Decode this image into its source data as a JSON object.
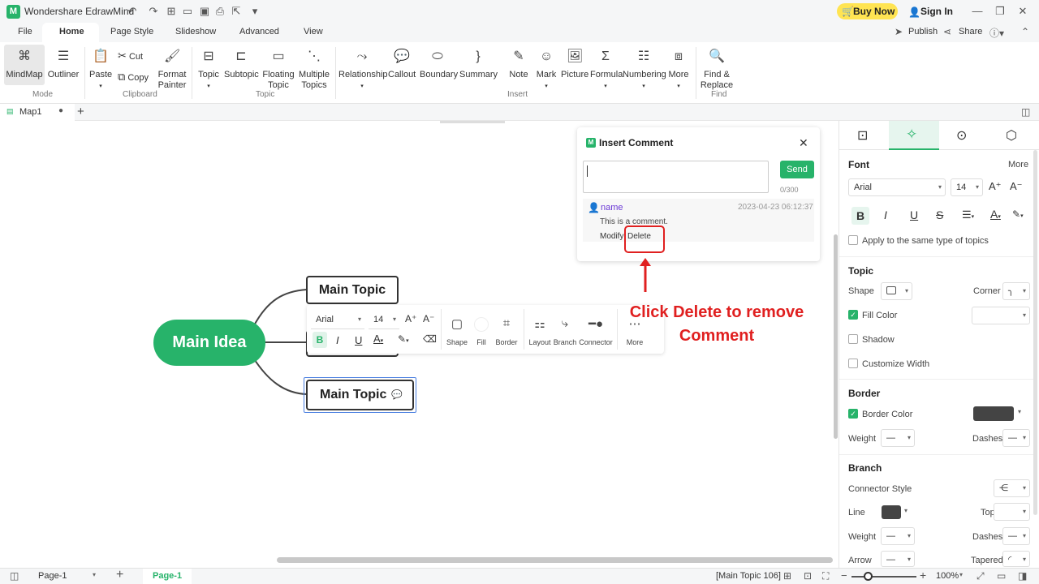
{
  "app": {
    "title": "Wondershare EdrawMind",
    "buy_now": "Buy Now",
    "sign_in": "Sign In",
    "publish": "Publish",
    "share": "Share"
  },
  "menu": [
    "File",
    "Home",
    "Page Style",
    "Slideshow",
    "Advanced",
    "View"
  ],
  "ribbon": {
    "mode": {
      "label": "Mode",
      "mindmap": "MindMap",
      "outliner": "Outliner"
    },
    "clipboard": {
      "label": "Clipboard",
      "paste": "Paste",
      "cut": "Cut",
      "copy": "Copy",
      "format_painter_1": "Format",
      "format_painter_2": "Painter"
    },
    "topic": {
      "label": "Topic",
      "topic": "Topic",
      "subtopic": "Subtopic",
      "floating_1": "Floating",
      "floating_2": "Topic",
      "multiple_1": "Multiple",
      "multiple_2": "Topics"
    },
    "insert": {
      "label": "Insert",
      "relationship": "Relationship",
      "callout": "Callout",
      "boundary": "Boundary",
      "summary": "Summary",
      "note": "Note",
      "mark": "Mark",
      "picture": "Picture",
      "formula": "Formula",
      "numbering": "Numbering",
      "more": "More"
    },
    "find": {
      "label": "Find",
      "find_1": "Find &",
      "find_2": "Replace"
    }
  },
  "doc_tab": {
    "name": "Map1"
  },
  "mindmap": {
    "central": "Main Idea",
    "topic1": "Main Topic",
    "topic3": "Main Topic"
  },
  "floatbar": {
    "font": "Arial",
    "size": "14",
    "shape": "Shape",
    "fill": "Fill",
    "border": "Border",
    "layout": "Layout",
    "branch": "Branch",
    "connector": "Connector",
    "more": "More"
  },
  "comment": {
    "title": "Insert Comment",
    "send": "Send",
    "counter": "0/300",
    "user": "name",
    "timestamp": "2023-04-23 06:12:37",
    "text": "This is a comment.",
    "modify": "Modify",
    "delete": "Delete"
  },
  "annotation": {
    "line1": "Click Delete to remove",
    "line2": "Comment"
  },
  "rpanel": {
    "font_h": "Font",
    "more": "More",
    "font": "Arial",
    "size": "14",
    "apply_same": "Apply to the same type of topics",
    "topic_h": "Topic",
    "shape": "Shape",
    "corner": "Corner",
    "fill_color": "Fill Color",
    "shadow": "Shadow",
    "custom_width": "Customize Width",
    "border_h": "Border",
    "border_color": "Border Color",
    "weight": "Weight",
    "dashes": "Dashes",
    "branch_h": "Branch",
    "connector_style": "Connector Style",
    "line": "Line",
    "topic": "Topic",
    "weight2": "Weight",
    "dashes2": "Dashes",
    "arrow": "Arrow",
    "tapered": "Tapered"
  },
  "status": {
    "page_select": "Page-1",
    "page_tab": "Page-1",
    "selection": "[Main Topic 106]",
    "zoom": "100%"
  },
  "colors": {
    "accent": "#27b36a",
    "annotation_red": "#e02020",
    "selection_blue": "#4a7fe0",
    "buy_yellow": "#ffe452"
  }
}
